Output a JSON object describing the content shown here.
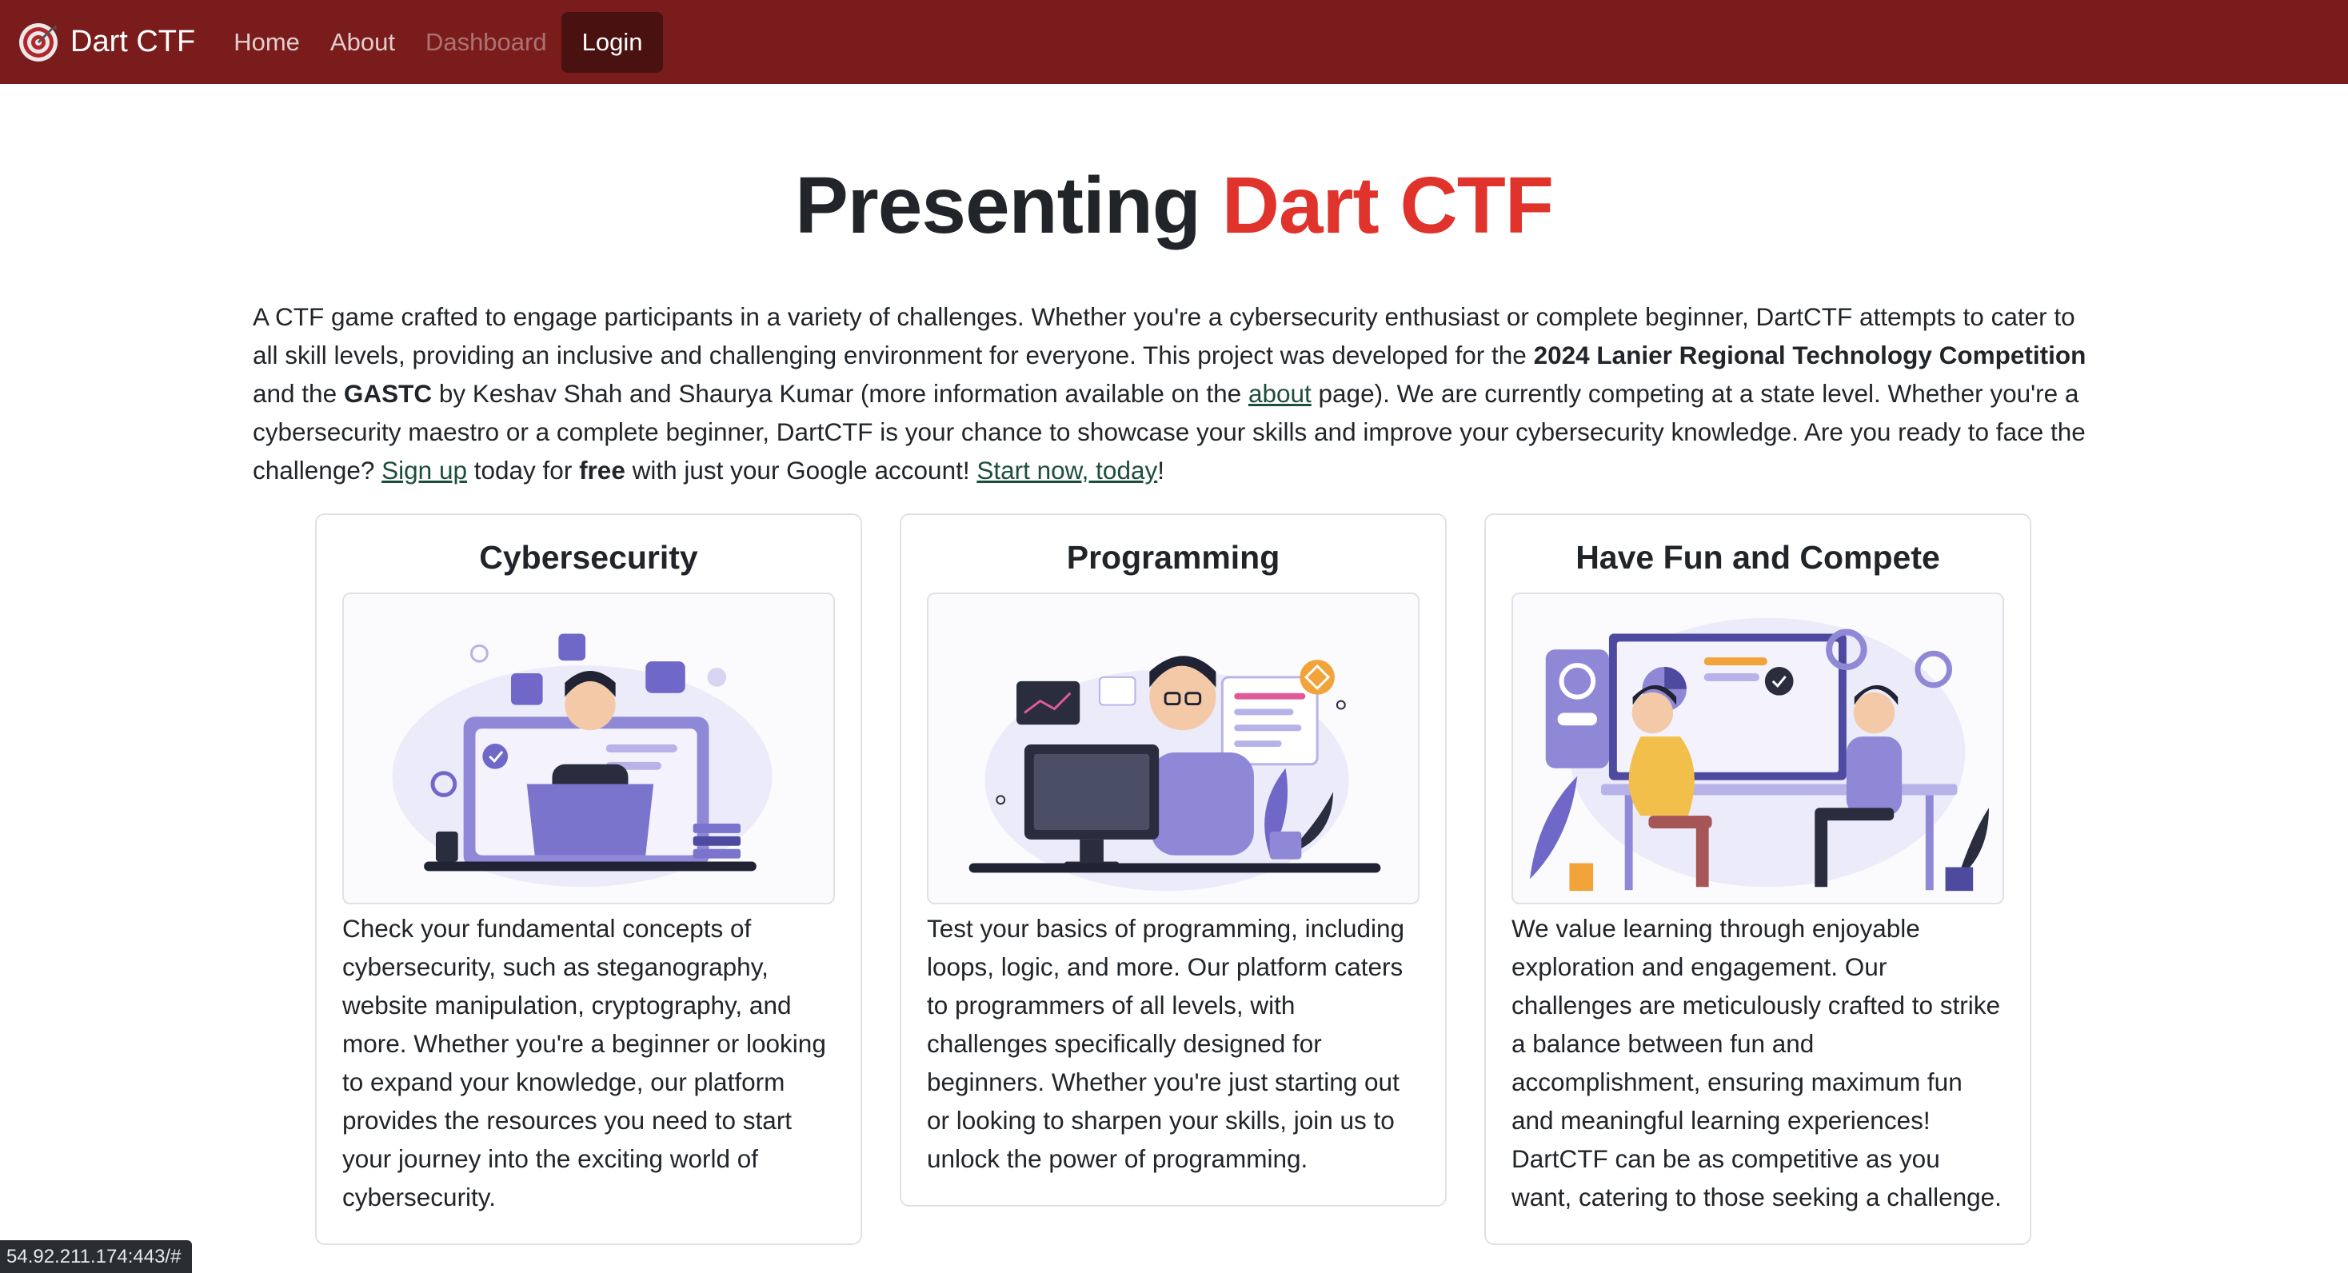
{
  "navbar": {
    "brand": "Dart CTF",
    "links": [
      {
        "label": "Home"
      },
      {
        "label": "About"
      },
      {
        "label": "Dashboard"
      }
    ],
    "login": "Login",
    "bg_color": "#7a1c1c"
  },
  "hero": {
    "title_prefix": "Presenting",
    "title_accent": "Dart CTF",
    "accent_color": "#e0332b"
  },
  "intro": {
    "t1": "A CTF game crafted to engage participants in a variety of challenges. Whether you're a cybersecurity enthusiast or complete beginner, DartCTF attempts to cater to all skill levels, providing an inclusive and challenging environment for everyone. This project was developed for the ",
    "b1": "2024 Lanier Regional Technology Competition",
    "t2": " and the ",
    "b2": "GASTC",
    "t3": " by Keshav Shah and Shaurya Kumar (more information available on the ",
    "about_link": "about",
    "t4": " page). We are currently competing at a state level. Whether you're a cybersecurity maestro or a complete beginner, DartCTF is your chance to showcase your skills and improve your cybersecurity knowledge. Are you ready to face the challenge? ",
    "signup_link": "Sign up",
    "t5": " today for ",
    "b3": "free",
    "t6": " with just your Google account! ",
    "start_link": "Start now, today",
    "t7": "!"
  },
  "cards": [
    {
      "title": "Cybersecurity",
      "body": "Check your fundamental concepts of cybersecurity, such as steganography, website manipulation, cryptography, and more. Whether you're a beginner or looking to expand your knowledge, our platform provides the resources you need to start your journey into the exciting world of cybersecurity."
    },
    {
      "title": "Programming",
      "body": "Test your basics of programming, including loops, logic, and more. Our platform caters to programmers of all levels, with challenges specifically designed for beginners. Whether you're just starting out or looking to sharpen your skills, join us to unlock the power of programming."
    },
    {
      "title": "Have Fun and Compete",
      "body": "We value learning through enjoyable exploration and engagement. Our challenges are meticulously crafted to strike a balance between fun and accomplishment, ensuring maximum fun and meaningful learning experiences! DartCTF can be as competitive as you want, catering to those seeking a challenge."
    }
  ],
  "status_bar": {
    "url": "54.92.211.174:443/#"
  }
}
